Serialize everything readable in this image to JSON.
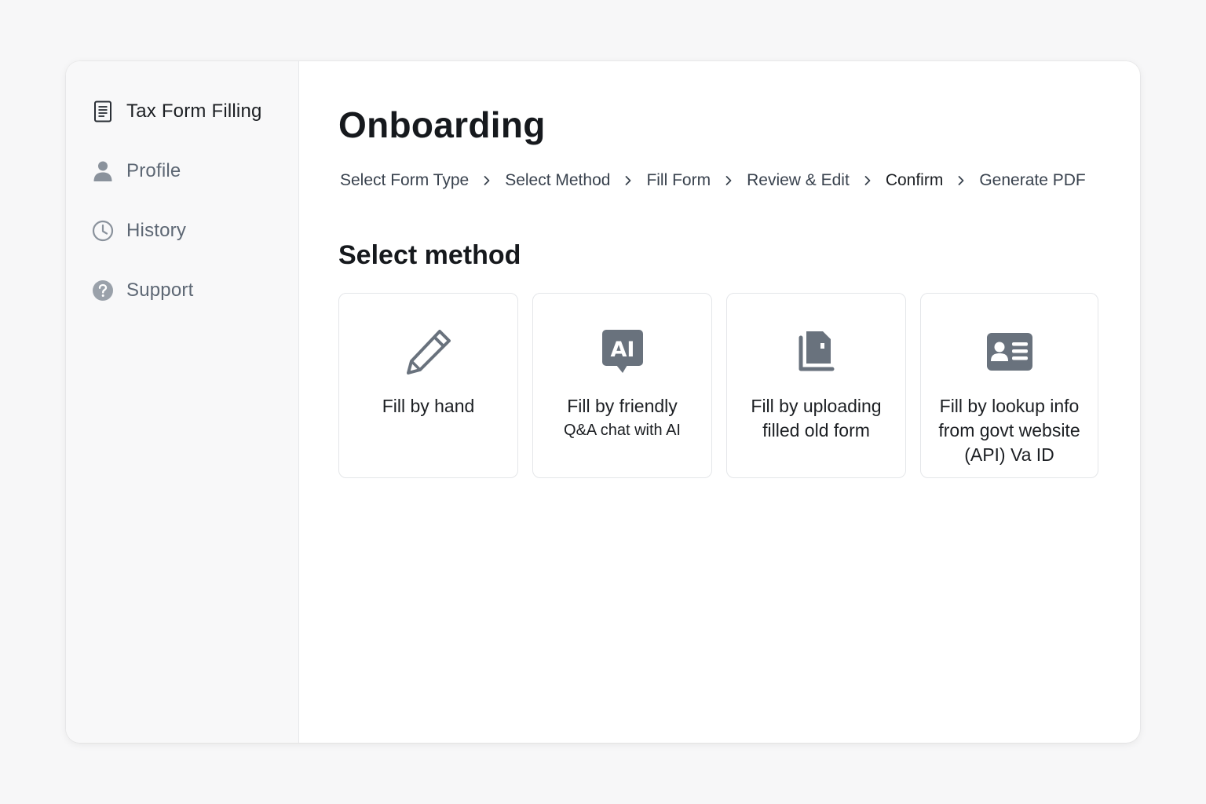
{
  "sidebar": {
    "items": [
      {
        "label": "Tax Form Filling",
        "icon": "document-icon",
        "active": true
      },
      {
        "label": "Profile",
        "icon": "user-icon",
        "active": false
      },
      {
        "label": "History",
        "icon": "clock-icon",
        "active": false
      },
      {
        "label": "Support",
        "icon": "help-icon",
        "active": false
      }
    ]
  },
  "main": {
    "title": "Onboarding",
    "breadcrumb": [
      {
        "label": "Select Form Type"
      },
      {
        "label": "Select Method"
      },
      {
        "label": "Fill Form"
      },
      {
        "label": "Review & Edit"
      },
      {
        "label": "Confirm"
      },
      {
        "label": "Generate PDF"
      }
    ],
    "section_title": "Select method",
    "methods": [
      {
        "label": "Fill by hand",
        "sub": "",
        "icon": "pencil-icon"
      },
      {
        "label": "Fill by friendly",
        "sub": "Q&A chat with AI",
        "icon": "ai-chat-icon"
      },
      {
        "label": "Fill by uploading filled old form",
        "sub": "",
        "icon": "upload-document-icon"
      },
      {
        "label": "Fill by lookup info from govt website (API) Va ID",
        "sub": "",
        "icon": "id-card-icon"
      }
    ]
  },
  "colors": {
    "icon_gray": "#69727d",
    "text_primary": "#1c1f23",
    "text_muted": "#5d6774"
  }
}
